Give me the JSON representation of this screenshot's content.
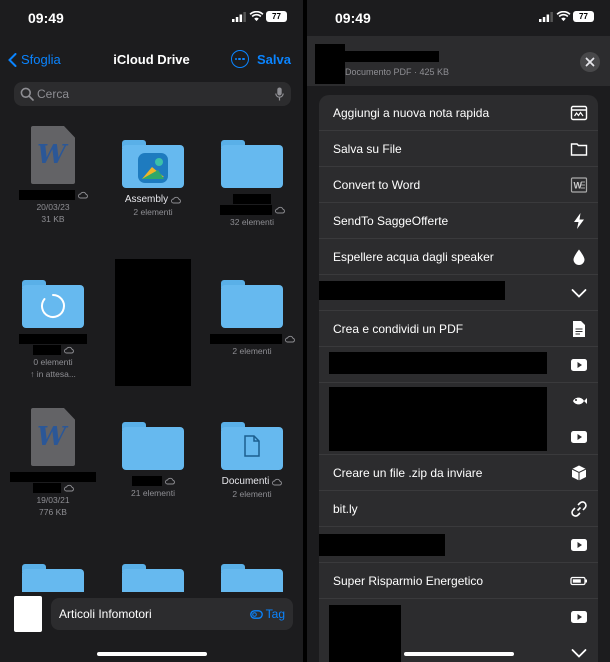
{
  "status": {
    "time": "09:49",
    "battery": "77"
  },
  "left": {
    "nav": {
      "back": "Sfoglia",
      "title": "iCloud Drive",
      "save": "Salva"
    },
    "search_placeholder": "Cerca",
    "tiles": [
      {
        "name": "",
        "meta1": "20/03/23",
        "meta2": "31 KB"
      },
      {
        "name": "Assembly",
        "meta1": "2 elementi",
        "meta2": ""
      },
      {
        "name": "",
        "meta1": "32 elementi",
        "meta2": ""
      },
      {
        "name": "",
        "meta1": "0 elementi",
        "meta2": "↑ in attesa..."
      },
      {
        "name": "",
        "meta1": "",
        "meta2": ""
      },
      {
        "name": "",
        "meta1": "2 elementi",
        "meta2": ""
      },
      {
        "name": "",
        "meta1": "19/03/21",
        "meta2": "776 KB"
      },
      {
        "name": "",
        "meta1": "21 elementi",
        "meta2": ""
      },
      {
        "name": "Documenti",
        "meta1": "2 elementi",
        "meta2": ""
      }
    ],
    "bottom": {
      "filename": "Articoli Infomotori",
      "tag": "Tag"
    }
  },
  "right": {
    "file_meta": "Documento PDF · 425 KB",
    "actions": [
      {
        "label": "Aggiungi a nuova nota rapida",
        "icon": "quick-note-icon"
      },
      {
        "label": "Salva su File",
        "icon": "folder-icon"
      },
      {
        "label": "Convert to Word",
        "icon": "word-icon"
      },
      {
        "label": "SendTo SaggeOfferte",
        "icon": "bolt-icon"
      },
      {
        "label": "Espellere acqua dagli speaker",
        "icon": "drop-icon"
      },
      {
        "label": "",
        "icon": "chevron-down-icon"
      },
      {
        "label": "Crea e condividi un PDF",
        "icon": "document-icon"
      },
      {
        "label": "",
        "icon": "play-icon"
      },
      {
        "label": "",
        "icon": "fish-icon"
      },
      {
        "label": "",
        "icon": "play-icon"
      },
      {
        "label": "Creare un file .zip da inviare",
        "icon": "cube-icon"
      },
      {
        "label": "bit.ly",
        "icon": "link-icon"
      },
      {
        "label": "",
        "icon": "play-icon"
      },
      {
        "label": "Super Risparmio Energetico",
        "icon": "battery-icon"
      },
      {
        "label": "",
        "icon": "play-icon"
      },
      {
        "label": "",
        "icon": "chevron-down-icon"
      }
    ]
  }
}
